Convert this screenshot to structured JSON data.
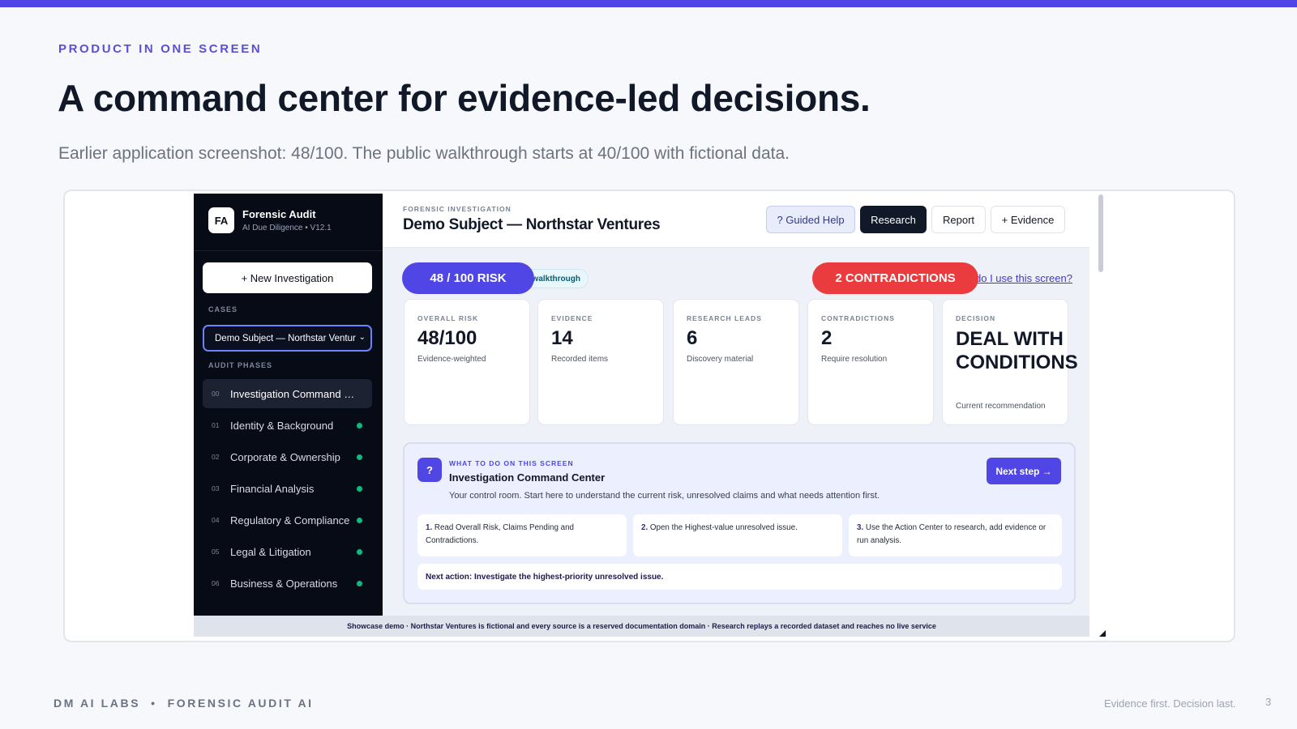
{
  "slide": {
    "eyebrow": "PRODUCT IN ONE SCREEN",
    "headline": "A command center for evidence-led decisions.",
    "subline": "Earlier application screenshot: 48/100. The public walkthrough starts at 40/100 with fictional data.",
    "footer_left": "DM AI LABS  •  FORENSIC AUDIT AI",
    "footer_tagline": "Evidence first. Decision last.",
    "page_number": "3",
    "accent_color": "#4f46e5"
  },
  "app": {
    "brand": {
      "logo": "FA",
      "title": "Forensic Audit",
      "subtitle": "AI Due Diligence • V12.1"
    },
    "new_investigation": "+ New Investigation",
    "cases_label": "CASES",
    "selected_case": "Demo Subject — Northstar Ventures",
    "phases_label": "AUDIT PHASES",
    "phases": [
      {
        "num": "00",
        "name": "Investigation Command Center",
        "active": true
      },
      {
        "num": "01",
        "name": "Identity & Background"
      },
      {
        "num": "02",
        "name": "Corporate & Ownership"
      },
      {
        "num": "03",
        "name": "Financial Analysis"
      },
      {
        "num": "04",
        "name": "Regulatory & Compliance"
      },
      {
        "num": "05",
        "name": "Legal & Litigation"
      },
      {
        "num": "06",
        "name": "Business & Operations"
      }
    ],
    "header": {
      "eyebrow": "FORENSIC INVESTIGATION",
      "title": "Demo Subject — Northstar Ventures",
      "guided_help": "? Guided Help",
      "research": "Research",
      "report": "Report",
      "evidence": "+ Evidence"
    },
    "risk_pill": "48 / 100 RISK",
    "walkthrough_pill": "walkthrough",
    "contradictions_pill": "2 CONTRADICTIONS",
    "howto_link": "do I use this screen?",
    "metrics": [
      {
        "label": "OVERALL RISK",
        "value": "48/100",
        "sub": "Evidence-weighted"
      },
      {
        "label": "EVIDENCE",
        "value": "14",
        "sub": "Recorded items"
      },
      {
        "label": "RESEARCH LEADS",
        "value": "6",
        "sub": "Discovery material"
      },
      {
        "label": "CONTRADICTIONS",
        "value": "2",
        "sub": "Require resolution"
      },
      {
        "label": "DECISION",
        "value": "DEAL WITH CONDITIONS",
        "sub": "Current recommendation"
      }
    ],
    "guide": {
      "icon": "?",
      "eyebrow": "WHAT TO DO ON THIS SCREEN",
      "title": "Investigation Command Center",
      "description": "Your control room. Start here to understand the current risk, unresolved claims and what needs attention first.",
      "next_button": "Next step →",
      "steps": [
        {
          "num": "1.",
          "text": "Read Overall Risk, Claims Pending and Contradictions."
        },
        {
          "num": "2.",
          "text": "Open the Highest-value unresolved issue."
        },
        {
          "num": "3.",
          "text": "Use the Action Center to research, add evidence or run analysis."
        }
      ],
      "next_action": "Next action: Investigate the highest-priority unresolved issue."
    },
    "demo_banner": "Showcase demo · Northstar Ventures is fictional and every source is a reserved documentation domain · Research replays a recorded dataset and reaches no live service"
  }
}
